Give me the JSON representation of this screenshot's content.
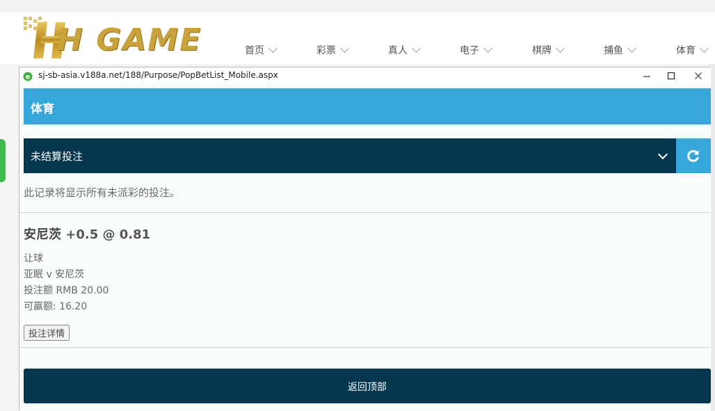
{
  "site": {
    "logo_text": "H GAME",
    "nav": [
      {
        "label": "首页"
      },
      {
        "label": "彩票"
      },
      {
        "label": "真人"
      },
      {
        "label": "电子"
      },
      {
        "label": "棋牌"
      },
      {
        "label": "捕鱼"
      },
      {
        "label": "体育"
      }
    ]
  },
  "popup": {
    "url": "sj-sb-asia.v188a.net/188/Purpose/PopBetList_Mobile.aspx",
    "window_controls": {
      "minimize": "minimize-icon",
      "maximize": "maximize-icon",
      "close": "close-icon"
    },
    "sport_title": "体育",
    "bet_filter": "未结算投注",
    "info_text": "此记录将显示所有未派彩的投注。",
    "bet": {
      "selection": "安尼茨",
      "odds": "+0.5 @ 0.81",
      "market": "让球",
      "match": "亚眠 v 安尼茨",
      "stake": "投注额 RMB 20.00",
      "payout": "可赢额: 16.20",
      "details_button": "投注详情"
    },
    "back_to_top": "返回顶部"
  },
  "colors": {
    "header_blue": "#35a7dd",
    "dark_navy": "#05364f",
    "logo_gold": "#c9a23a"
  }
}
